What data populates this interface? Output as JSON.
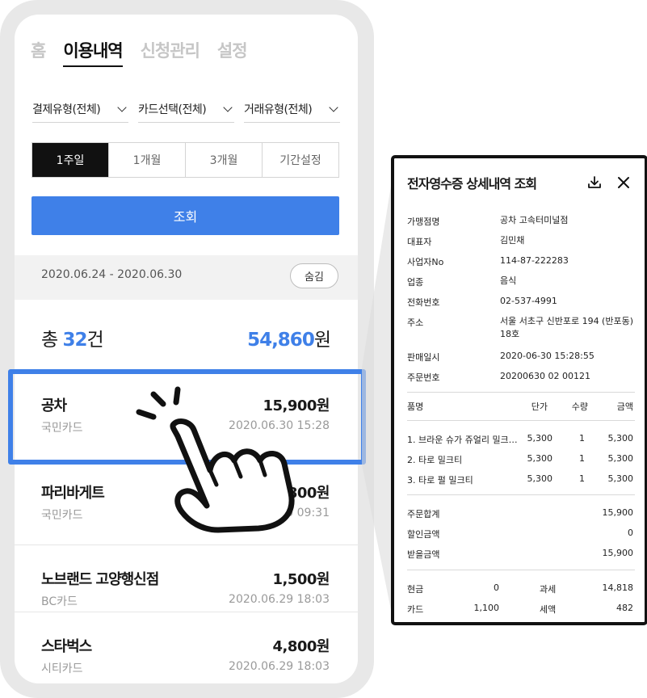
{
  "tabs": [
    {
      "label": "홈",
      "active": false
    },
    {
      "label": "이용내역",
      "active": true
    },
    {
      "label": "신청관리",
      "active": false
    },
    {
      "label": "설정",
      "active": false
    }
  ],
  "filters": [
    "결제유형(전체)",
    "카드선택(전체)",
    "거래유형(전체)"
  ],
  "periods": [
    {
      "label": "1주일",
      "active": true
    },
    {
      "label": "1개월",
      "active": false
    },
    {
      "label": "3개월",
      "active": false
    },
    {
      "label": "기간설정",
      "active": false
    }
  ],
  "search_button": "조회",
  "period_range": "2020.06.24 - 2020.06.30",
  "hide_button": "숨김",
  "summary": {
    "prefix": "총 ",
    "count": "32",
    "count_unit": "건",
    "amount": "54,860",
    "amount_unit": "원"
  },
  "transactions": [
    {
      "name": "공차",
      "amount": "15,900원",
      "card": "국민카드",
      "datetime": "2020.06.30 15:28"
    },
    {
      "name": "파리바게트",
      "amount": "3,800원",
      "card": "국민카드",
      "datetime": "2020.06.30 09:31"
    },
    {
      "name": "노브랜드 고양행신점",
      "amount": "1,500원",
      "card": "BC카드",
      "datetime": "2020.06.29 18:03"
    },
    {
      "name": "스타벅스",
      "amount": "4,800원",
      "card": "시티카드",
      "datetime": "2020.06.29 18:03"
    }
  ],
  "receipt": {
    "title": "전자영수증 상세내역 조회",
    "info": [
      {
        "label": "가맹점명",
        "value": "공차 고속터미널점"
      },
      {
        "label": "대표자",
        "value": "김민채"
      },
      {
        "label": "사업자No",
        "value": "114-87-222283"
      },
      {
        "label": "업종",
        "value": "음식"
      },
      {
        "label": "전화번호",
        "value": "02-537-4991"
      },
      {
        "label": "주소",
        "value": "서울 서초구 신반포로 194 (반포동) 18호"
      },
      {
        "label": "판매일시",
        "value": "2020-06-30 15:28:55"
      },
      {
        "label": "주문번호",
        "value": "20200630 02 00121"
      }
    ],
    "items_header": {
      "name": "품명",
      "unit_price": "단가",
      "qty": "수량",
      "amount": "금액"
    },
    "items": [
      {
        "name": "1. 브라운 슈가 쥬얼리 밀크…",
        "unit_price": "5,300",
        "qty": "1",
        "amount": "5,300"
      },
      {
        "name": "2. 타로 밀크티",
        "unit_price": "5,300",
        "qty": "1",
        "amount": "5,300"
      },
      {
        "name": "3. 타로 펄 밀크티",
        "unit_price": "5,300",
        "qty": "1",
        "amount": "5,300"
      }
    ],
    "totals": [
      {
        "label": "주문합계",
        "value": "15,900"
      },
      {
        "label": "할인금액",
        "value": "0"
      },
      {
        "label": "받을금액",
        "value": "15,900"
      }
    ],
    "payments": [
      {
        "label": "현금",
        "value": "0",
        "tax_label": "과세",
        "tax_value": "14,818"
      },
      {
        "label": "카드",
        "value": "1,100",
        "tax_label": "세액",
        "tax_value": "482"
      }
    ]
  },
  "colors": {
    "accent": "#3f80e8",
    "frame": "#e8e8e8",
    "dark": "#111111"
  },
  "icons": [
    "chevron-down-icon",
    "download-icon",
    "close-icon",
    "pointing-hand-icon"
  ]
}
